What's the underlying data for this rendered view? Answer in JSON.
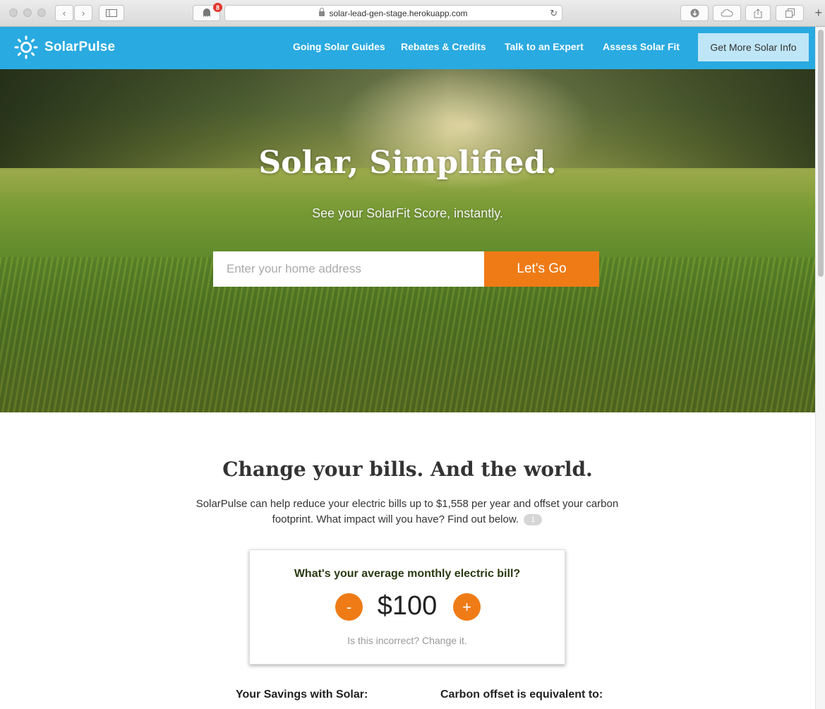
{
  "browser": {
    "url": "solar-lead-gen-stage.herokuapp.com",
    "extension_badge": "8"
  },
  "nav": {
    "brand": "SolarPulse",
    "links": [
      "Going Solar Guides",
      "Rebates & Credits",
      "Talk to an Expert",
      "Assess Solar Fit"
    ],
    "cta": "Get More Solar Info"
  },
  "hero": {
    "title": "Solar, Simplified.",
    "subtitle": "See your SolarFit Score, instantly.",
    "address_placeholder": "Enter your home address",
    "button": "Let's Go"
  },
  "impact": {
    "title": "Change your bills. And the world.",
    "description": "SolarPulse can help reduce your electric bills up to $1,558 per year and offset your carbon footprint. What impact will you have? Find out below.",
    "footnote": "1"
  },
  "bill": {
    "question": "What's your average monthly electric bill?",
    "decrement": "-",
    "amount": "$100",
    "increment": "+",
    "change_link": "Is this incorrect? Change it."
  },
  "results": {
    "savings_label": "Your Savings with Solar:",
    "carbon_label": "Carbon offset is equivalent to:"
  },
  "colors": {
    "nav_blue": "#29aae1",
    "accent_orange": "#ef7b16",
    "cta_light_blue": "#bfe6f7",
    "savings_green": "#7ab648"
  }
}
